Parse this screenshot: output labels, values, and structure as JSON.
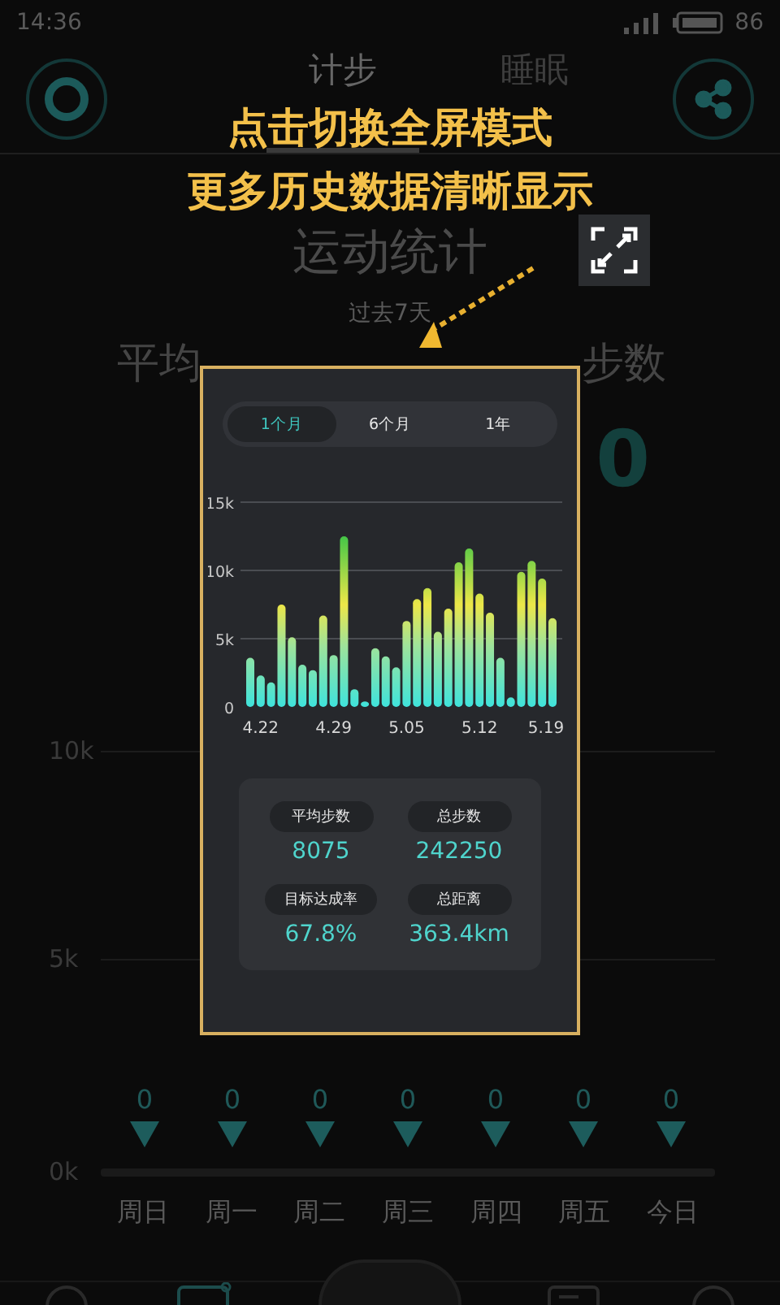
{
  "status_bar": {
    "time": "14:36",
    "battery": "86"
  },
  "header_tabs": [
    {
      "label": "计步",
      "selected": true
    },
    {
      "label": "睡眠",
      "selected": false
    }
  ],
  "overlay_caption": [
    "点击切换全屏模式",
    "更多历史数据清晰显示"
  ],
  "background_screen": {
    "title": "运动统计",
    "subtitle": "过去7天",
    "stat_labels": [
      "平均",
      "步数"
    ],
    "stat_value": "0",
    "y_axis": [
      "10k",
      "5k",
      "0k"
    ],
    "days": [
      {
        "label": "周日",
        "value": "0"
      },
      {
        "label": "周一",
        "value": "0"
      },
      {
        "label": "周二",
        "value": "0"
      },
      {
        "label": "周三",
        "value": "0"
      },
      {
        "label": "周四",
        "value": "0"
      },
      {
        "label": "周五",
        "value": "0"
      },
      {
        "label": "今日",
        "value": "0"
      }
    ]
  },
  "popup": {
    "tabs": [
      {
        "label": "1个月",
        "selected": true
      },
      {
        "label": "6个月",
        "selected": false
      },
      {
        "label": "1年",
        "selected": false
      }
    ],
    "chart_data": {
      "type": "bar",
      "ylim": [
        0,
        15000
      ],
      "categories": [
        null,
        "4.22",
        null,
        null,
        null,
        null,
        null,
        null,
        "4.29",
        null,
        null,
        null,
        null,
        null,
        null,
        "5.05",
        null,
        null,
        null,
        null,
        null,
        null,
        "5.12",
        null,
        null,
        null,
        null,
        null,
        null,
        "5.19"
      ],
      "yticks": [
        0,
        {
          "value": 5000,
          "label": "5k"
        },
        {
          "value": 10000,
          "label": "10k"
        },
        {
          "value": 15000,
          "label": "15k"
        }
      ],
      "values": [
        3600,
        2300,
        1800,
        7500,
        5100,
        3100,
        2700,
        6700,
        3800,
        12500,
        1300,
        400,
        4300,
        3700,
        2900,
        6300,
        7900,
        8700,
        5500,
        7200,
        10600,
        11600,
        8300,
        6900,
        3600,
        700,
        9900,
        10700,
        9400,
        6500
      ]
    },
    "stats": [
      {
        "label": "平均步数",
        "value": "8075"
      },
      {
        "label": "总步数",
        "value": "242250"
      },
      {
        "label": "目标达成率",
        "value": "67.8%"
      },
      {
        "label": "总距离",
        "value": "363.4km"
      }
    ]
  }
}
